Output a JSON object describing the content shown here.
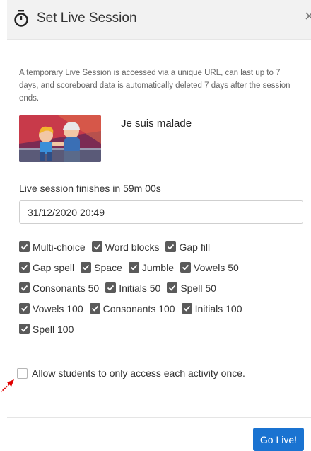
{
  "dialog": {
    "title": "Set Live Session",
    "close_glyph": "×",
    "description": "A temporary Live Session is accessed via a unique URL, can last up to 7 days, and scoreboard data is automatically deleted 7 days after the session ends."
  },
  "set": {
    "title": "Je suis malade"
  },
  "session": {
    "finish_text": "Live session finishes in 59m 00s",
    "end_datetime": "31/12/2020 20:49"
  },
  "activities": [
    [
      {
        "label": "Multi-choice",
        "checked": true
      },
      {
        "label": "Word blocks",
        "checked": true
      },
      {
        "label": "Gap fill",
        "checked": true
      }
    ],
    [
      {
        "label": "Gap spell",
        "checked": true
      },
      {
        "label": "Space",
        "checked": true
      },
      {
        "label": "Jumble",
        "checked": true
      },
      {
        "label": "Vowels 50",
        "checked": true
      }
    ],
    [
      {
        "label": "Consonants 50",
        "checked": true
      },
      {
        "label": "Initials 50",
        "checked": true
      },
      {
        "label": "Spell 50",
        "checked": true
      }
    ],
    [
      {
        "label": "Vowels 100",
        "checked": true
      },
      {
        "label": "Consonants 100",
        "checked": true
      },
      {
        "label": "Initials 100",
        "checked": true
      }
    ],
    [
      {
        "label": "Spell 100",
        "checked": true
      }
    ]
  ],
  "options": {
    "once_label": "Allow students to only access each activity once.",
    "once_checked": false
  },
  "footer": {
    "go_live_label": "Go Live!"
  },
  "colors": {
    "accent": "#1a73d1",
    "checkbox": "#5a5a5a",
    "annotation_arrow": "#e00000"
  },
  "icons": {
    "title": "stopwatch-icon",
    "close": "close-icon",
    "check": "check-icon",
    "annotation": "red-arrow-icon"
  }
}
